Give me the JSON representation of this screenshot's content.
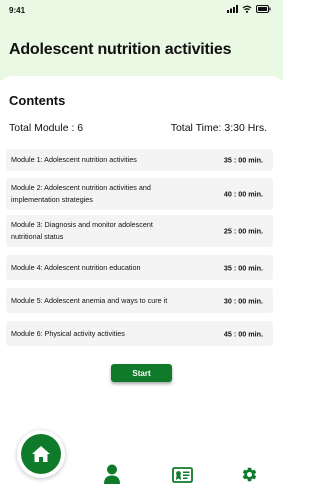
{
  "status": {
    "time": "9:41"
  },
  "header": {
    "title": "Adolescent nutrition activities"
  },
  "contents_label": "Contents",
  "summary": {
    "total_module": "Total Module : 6",
    "total_time": "Total Time: 3:30 Hrs."
  },
  "modules": [
    {
      "label": "Module 1: Adolescent nutrition activities",
      "time": "35 : 00 min."
    },
    {
      "label": "Module 2: Adolescent nutrition activities and implementation strategies",
      "time": "40 : 00 min."
    },
    {
      "label": "Module 3: Diagnosis and monitor adolescent nutritional status",
      "time": "25 : 00 min."
    },
    {
      "label": "Module 4: Adolescent nutrition education",
      "time": "35 : 00 min."
    },
    {
      "label": "Module 5: Adolescent anemia and ways to cure it",
      "time": "30 : 00 min."
    },
    {
      "label": "Module 6: Physical activity activities",
      "time": "45 : 00 min."
    }
  ],
  "start_label": "Start",
  "nav": {
    "items": [
      "home-icon",
      "profile-icon",
      "certificate-icon",
      "settings-icon"
    ]
  },
  "colors": {
    "header_bg": "#e9f9e4",
    "accent": "#0f7a2a",
    "module_bg": "#f4f4f4"
  }
}
